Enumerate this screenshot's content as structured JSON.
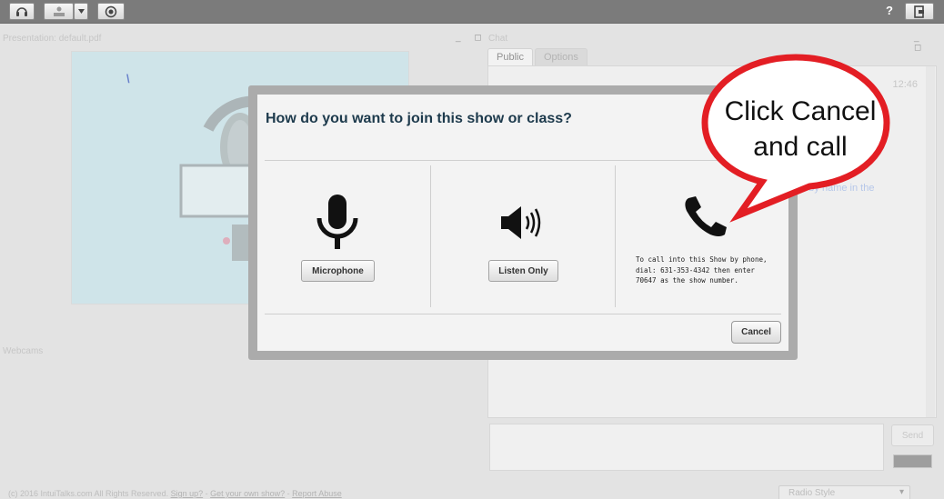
{
  "toolbar": {
    "help_label": "?"
  },
  "presentation": {
    "title": "Presentation: default.pdf",
    "window_controls": "_ ◻"
  },
  "chat": {
    "title": "Chat",
    "window_controls": "_ ◻",
    "tabs": [
      {
        "label": "Public"
      },
      {
        "label": "Options"
      }
    ],
    "timestamp": "12:46",
    "partial_message": "ed by name in the",
    "send_label": "Send"
  },
  "webcams": {
    "title": "Webcams"
  },
  "dialog": {
    "title": "How do you want to join this show or class?",
    "options": [
      {
        "label": "Microphone",
        "icon": "microphone-icon"
      },
      {
        "label": "Listen Only",
        "icon": "speaker-icon"
      },
      {
        "icon": "phone-icon",
        "text_lines": [
          "To call into this Show by phone,",
          "dial: 631-353-4342 then enter",
          "70647 as the show number."
        ]
      }
    ],
    "cancel_label": "Cancel"
  },
  "callout": {
    "lines": [
      "Click Cancel",
      "and call"
    ],
    "color": "#e31e24"
  },
  "footer": {
    "copyright": "(c) 2016 IntuiTalks.com All Rights Reserved.",
    "signup": "Sign up?",
    "sep1": " - ",
    "get_show": "Get your own show?",
    "sep2": " - ",
    "report": "Report Abuse"
  },
  "style_select": {
    "value": "Radio Style"
  },
  "colors": {
    "toolbar": "#7b7b7b",
    "slide_bg": "#b6d6dd",
    "dialog_title": "#1d3a4c"
  }
}
